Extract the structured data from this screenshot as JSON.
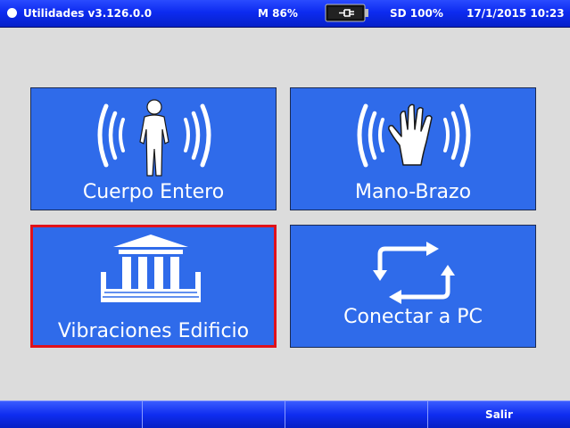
{
  "status": {
    "title": "Utilidades v3.126.0.0",
    "memory": "M 86%",
    "sd": "SD 100%",
    "datetime": "17/1/2015 10:23",
    "battery_icon": "battery-charging-icon"
  },
  "tiles": [
    {
      "label": "Cuerpo Entero",
      "icon": "whole-body-vibration-icon"
    },
    {
      "label": "Mano-Brazo",
      "icon": "hand-arm-vibration-icon"
    },
    {
      "label": "Vibraciones Edificio",
      "icon": "building-icon"
    },
    {
      "label": "Conectar a PC",
      "icon": "sync-icon"
    }
  ],
  "softkeys": [
    "",
    "",
    "",
    "Salir"
  ],
  "colors": {
    "tile_bg": "#2f6bea",
    "selected_border": "#e0121b",
    "bar_blue": "#0d2bf0"
  }
}
